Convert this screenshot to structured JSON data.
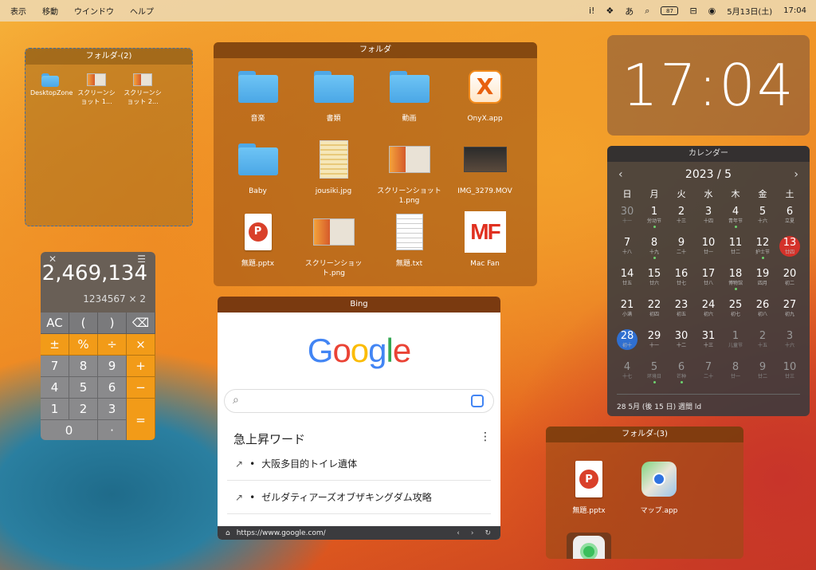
{
  "menubar": {
    "left": [
      "表示",
      "移動",
      "ウインドウ",
      "ヘルプ"
    ],
    "right": {
      "ime": "あ",
      "battery": "87",
      "date": "5月13日(土)",
      "time": "17:04"
    }
  },
  "folder2": {
    "title": "フォルダ-(2)",
    "items": [
      "DesktopZone",
      "スクリーンショット 1...",
      "スクリーンショット 2..."
    ]
  },
  "folder": {
    "title": "フォルダ",
    "items": [
      {
        "label": "音楽",
        "icon": "folder-icon"
      },
      {
        "label": "書類",
        "icon": "folder-icon"
      },
      {
        "label": "動画",
        "icon": "folder-icon"
      },
      {
        "label": "OnyX.app",
        "icon": "onyx-app-icon"
      },
      {
        "label": "Baby",
        "icon": "folder-icon"
      },
      {
        "label": "jousiki.jpg",
        "icon": "jpg-file-icon"
      },
      {
        "label": "スクリーンショット 1.png",
        "icon": "screenshot-file-icon"
      },
      {
        "label": "IMG_3279.MOV",
        "icon": "movie-file-icon"
      },
      {
        "label": "無題.pptx",
        "icon": "pptx-file-icon"
      },
      {
        "label": "スクリーンショット.png",
        "icon": "screenshot-file-icon"
      },
      {
        "label": "無題.txt",
        "icon": "txt-file-icon"
      },
      {
        "label": "Mac Fan",
        "icon": "macfan-icon"
      }
    ]
  },
  "clock": {
    "time": "17:04"
  },
  "calendar": {
    "title": "カレンダー",
    "month": "2023 / 5",
    "weekdays": [
      "日",
      "月",
      "火",
      "水",
      "木",
      "金",
      "土"
    ],
    "days": [
      {
        "n": "30",
        "s": "十一",
        "dim": true
      },
      {
        "n": "1",
        "s": "労动节",
        "dot": true
      },
      {
        "n": "2",
        "s": "十三"
      },
      {
        "n": "3",
        "s": "十四"
      },
      {
        "n": "4",
        "s": "青年节",
        "dot": true
      },
      {
        "n": "5",
        "s": "十六"
      },
      {
        "n": "6",
        "s": "立夏"
      },
      {
        "n": "7",
        "s": "十八"
      },
      {
        "n": "8",
        "s": "十九",
        "dot": true
      },
      {
        "n": "9",
        "s": "二十"
      },
      {
        "n": "10",
        "s": "廿一"
      },
      {
        "n": "11",
        "s": "廿二"
      },
      {
        "n": "12",
        "s": "护士节",
        "dot": true
      },
      {
        "n": "13",
        "s": "廿四",
        "mark": "red"
      },
      {
        "n": "14",
        "s": "廿五"
      },
      {
        "n": "15",
        "s": "廿六"
      },
      {
        "n": "16",
        "s": "廿七"
      },
      {
        "n": "17",
        "s": "廿八"
      },
      {
        "n": "18",
        "s": "博物馆",
        "dot": true
      },
      {
        "n": "19",
        "s": "四月"
      },
      {
        "n": "20",
        "s": "初二"
      },
      {
        "n": "21",
        "s": "小满"
      },
      {
        "n": "22",
        "s": "初四"
      },
      {
        "n": "23",
        "s": "初五"
      },
      {
        "n": "24",
        "s": "初六"
      },
      {
        "n": "25",
        "s": "初七"
      },
      {
        "n": "26",
        "s": "初八"
      },
      {
        "n": "27",
        "s": "初九"
      },
      {
        "n": "28",
        "s": "初十",
        "mark": "blue"
      },
      {
        "n": "29",
        "s": "十一"
      },
      {
        "n": "30",
        "s": "十二"
      },
      {
        "n": "31",
        "s": "十三"
      },
      {
        "n": "1",
        "s": "儿童节",
        "dim": true
      },
      {
        "n": "2",
        "s": "十五",
        "dim": true
      },
      {
        "n": "3",
        "s": "十六",
        "dim": true
      },
      {
        "n": "4",
        "s": "十七",
        "dim": true
      },
      {
        "n": "5",
        "s": "环境日",
        "dim": true,
        "dot": true
      },
      {
        "n": "6",
        "s": "芒种",
        "dim": true,
        "dot": true
      },
      {
        "n": "7",
        "s": "二十",
        "dim": true
      },
      {
        "n": "8",
        "s": "廿一",
        "dim": true
      },
      {
        "n": "9",
        "s": "廿二",
        "dim": true
      },
      {
        "n": "10",
        "s": "廿三",
        "dim": true
      }
    ],
    "footer": "28 5月 (後 15 日) 週間 ld"
  },
  "calculator": {
    "display": "2,469,134",
    "expression": "1234567 × 2",
    "close": "✕",
    "menu": "☰",
    "keys": [
      {
        "l": "AC",
        "c": "k-dark"
      },
      {
        "l": "(",
        "c": "k-dark"
      },
      {
        "l": ")",
        "c": "k-dark"
      },
      {
        "l": "⌫",
        "c": "k-dark"
      },
      {
        "l": "±",
        "c": "k-orange"
      },
      {
        "l": "%",
        "c": "k-orange"
      },
      {
        "l": "÷",
        "c": "k-orange"
      },
      {
        "l": "×",
        "c": "k-orange"
      },
      {
        "l": "7",
        "c": "k-num"
      },
      {
        "l": "8",
        "c": "k-num"
      },
      {
        "l": "9",
        "c": "k-num"
      },
      {
        "l": "+",
        "c": "k-orange"
      },
      {
        "l": "4",
        "c": "k-num"
      },
      {
        "l": "5",
        "c": "k-num"
      },
      {
        "l": "6",
        "c": "k-num"
      },
      {
        "l": "−",
        "c": "k-orange"
      },
      {
        "l": "1",
        "c": "k-num"
      },
      {
        "l": "2",
        "c": "k-num"
      },
      {
        "l": "3",
        "c": "k-num"
      },
      {
        "l": "=",
        "c": "k-orange"
      },
      {
        "l": "0",
        "c": "k-num"
      },
      {
        "l": "·",
        "c": "k-num"
      }
    ]
  },
  "bing": {
    "title": "Bing",
    "trending_title": "急上昇ワード",
    "trends": [
      "大阪多目的トイレ遺体",
      "ゼルダティアーズオブザキングダム攻略"
    ],
    "url": "https://www.google.com/"
  },
  "folder3": {
    "title": "フォルダ-(3)",
    "items": [
      {
        "label": "無題.pptx",
        "icon": "pptx-file-icon"
      },
      {
        "label": "マップ.app",
        "icon": "maps-app-icon"
      }
    ]
  }
}
